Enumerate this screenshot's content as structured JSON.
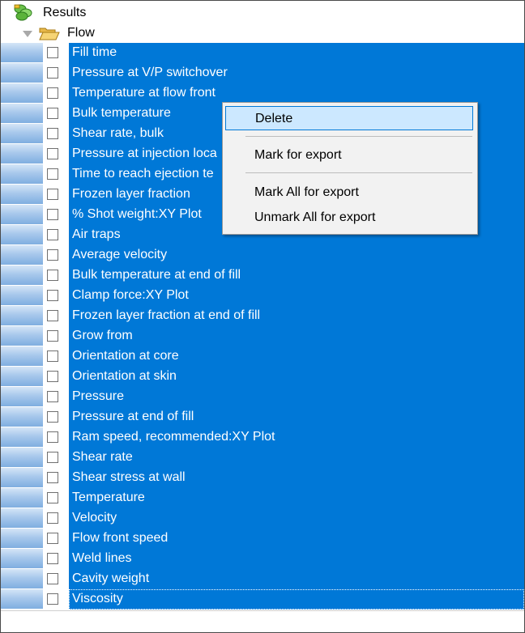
{
  "tree": {
    "root_label": "Results",
    "flow_label": "Flow",
    "items": [
      "Fill time",
      "Pressure at V/P switchover",
      "Temperature at flow front",
      "Bulk temperature",
      "Shear rate, bulk",
      "Pressure at injection loca",
      "Time to reach ejection te",
      "Frozen layer fraction",
      "% Shot weight:XY Plot",
      "Air traps",
      "Average velocity",
      "Bulk temperature at end of fill",
      "Clamp force:XY Plot",
      "Frozen layer fraction at end of fill",
      "Grow from",
      "Orientation at core",
      "Orientation at skin",
      "Pressure",
      "Pressure at end of fill",
      "Ram speed, recommended:XY Plot",
      "Shear rate",
      "Shear stress at wall",
      "Temperature",
      "Velocity",
      "Flow front speed",
      "Weld lines",
      "Cavity weight",
      "Viscosity"
    ]
  },
  "context_menu": {
    "delete": "Delete",
    "mark_for_export": "Mark for export",
    "mark_all_for_export": "Mark All for export",
    "unmark_all_for_export": "Unmark All for export"
  },
  "colors": {
    "selection": "#0078d7",
    "menu_highlight": "#cce8ff",
    "menu_background": "#f2f2f2"
  }
}
